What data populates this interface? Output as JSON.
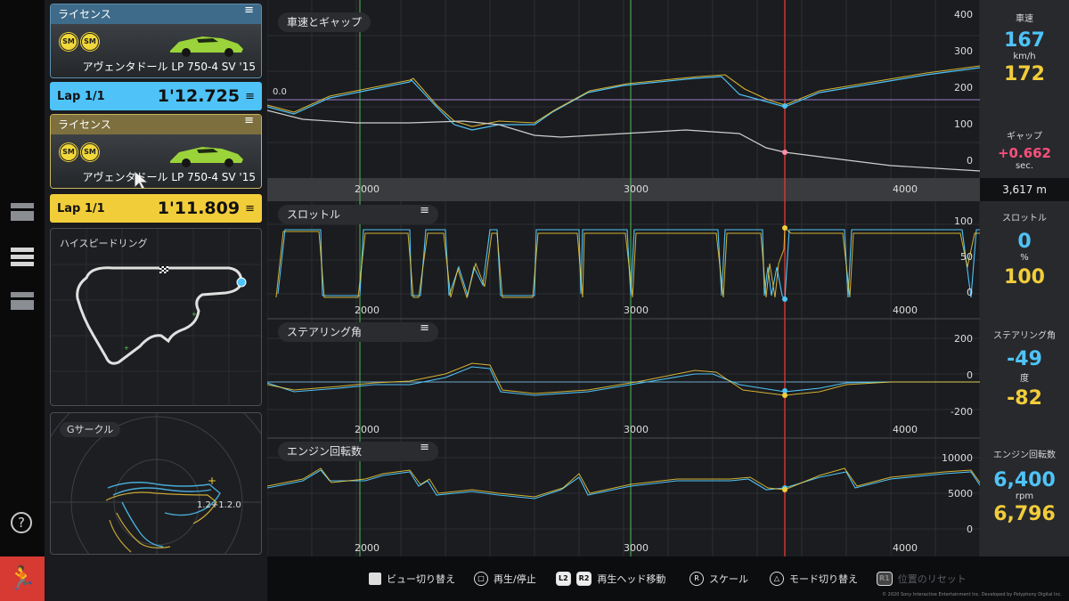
{
  "left_panel": {
    "card1": {
      "label": "ライセンス",
      "badge1": "SM",
      "badge2": "SM",
      "car_name": "アヴェンタドール LP 750-4 SV '15"
    },
    "lap1": {
      "label": "Lap 1/1",
      "time": "1'12.725"
    },
    "card2": {
      "label": "ライセンス",
      "badge1": "SM",
      "badge2": "SM",
      "car_name": "アヴェンタドール LP 750-4 SV '15"
    },
    "lap2": {
      "label": "Lap 1/1",
      "time": "1'11.809"
    },
    "track_map": {
      "title": "ハイスピードリング"
    },
    "g_circle": {
      "title": "Gサークル",
      "readout": "1.2+1.2.0"
    }
  },
  "graphs": {
    "speed_gap": {
      "title": "車速とギャップ",
      "y_ticks": [
        "400",
        "300",
        "200",
        "100",
        "0"
      ],
      "zero_label": "0.0"
    },
    "throttle": {
      "title": "スロットル",
      "y_ticks": [
        "100",
        "50",
        "0"
      ]
    },
    "steering": {
      "title": "ステアリング角",
      "y_ticks": [
        "200",
        "0",
        "-200"
      ]
    },
    "rpm": {
      "title": "エンジン回転数",
      "y_ticks": [
        "10000",
        "5000",
        "0"
      ]
    },
    "x_ticks": [
      "2000",
      "3000",
      "4000"
    ]
  },
  "readout": {
    "speed": {
      "label": "車速",
      "blue": "167",
      "unit": "km/h",
      "yellow": "172"
    },
    "gap": {
      "label": "ギャップ",
      "value": "+0.662",
      "unit": "sec."
    },
    "distance": "3,617 m",
    "throttle": {
      "label": "スロットル",
      "blue": "0",
      "unit": "%",
      "yellow": "100"
    },
    "steering": {
      "label": "ステアリング角",
      "blue": "-49",
      "unit": "度",
      "yellow": "-82"
    },
    "rpm": {
      "label": "エンジン回転数",
      "blue": "6,400",
      "unit": "rpm",
      "yellow": "6,796"
    }
  },
  "bottom_bar": {
    "view_switch": "ビュー切り替え",
    "play_pause": "再生/停止",
    "l2": "L2",
    "r2": "R2",
    "playhead": "再生ヘッド移動",
    "r_btn": "R",
    "scale": "スケール",
    "mode_switch": "モード切り替え",
    "r1": "R1",
    "reset_position": "位置のリセット",
    "copyright": "© 2020 Sony Interactive Entertainment Inc. Developed by Polyphony Digital Inc."
  },
  "colors": {
    "blue": "#4fc3f7",
    "yellow": "#f2cd3a",
    "accent_red": "#d63a32",
    "gap_pink": "#ff4f7b"
  }
}
